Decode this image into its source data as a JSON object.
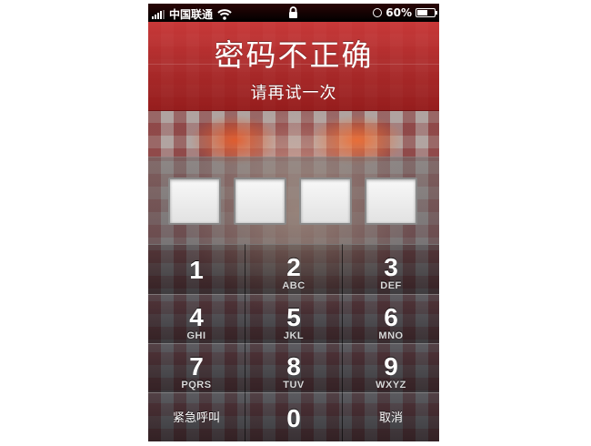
{
  "status_bar": {
    "carrier": "中国联通",
    "battery": "60%",
    "battery_level": 0.6
  },
  "header": {
    "title": "密码不正确",
    "subtitle": "请再试一次"
  },
  "passcode": {
    "boxes": 4
  },
  "keypad": {
    "keys": [
      {
        "num": "1",
        "letters": ""
      },
      {
        "num": "2",
        "letters": "ABC"
      },
      {
        "num": "3",
        "letters": "DEF"
      },
      {
        "num": "4",
        "letters": "GHI"
      },
      {
        "num": "5",
        "letters": "JKL"
      },
      {
        "num": "6",
        "letters": "MNO"
      },
      {
        "num": "7",
        "letters": "PQRS"
      },
      {
        "num": "8",
        "letters": "TUV"
      },
      {
        "num": "9",
        "letters": "WXYZ"
      }
    ],
    "emergency_label": "紧急呼叫",
    "zero": "0",
    "cancel_label": "取消"
  }
}
